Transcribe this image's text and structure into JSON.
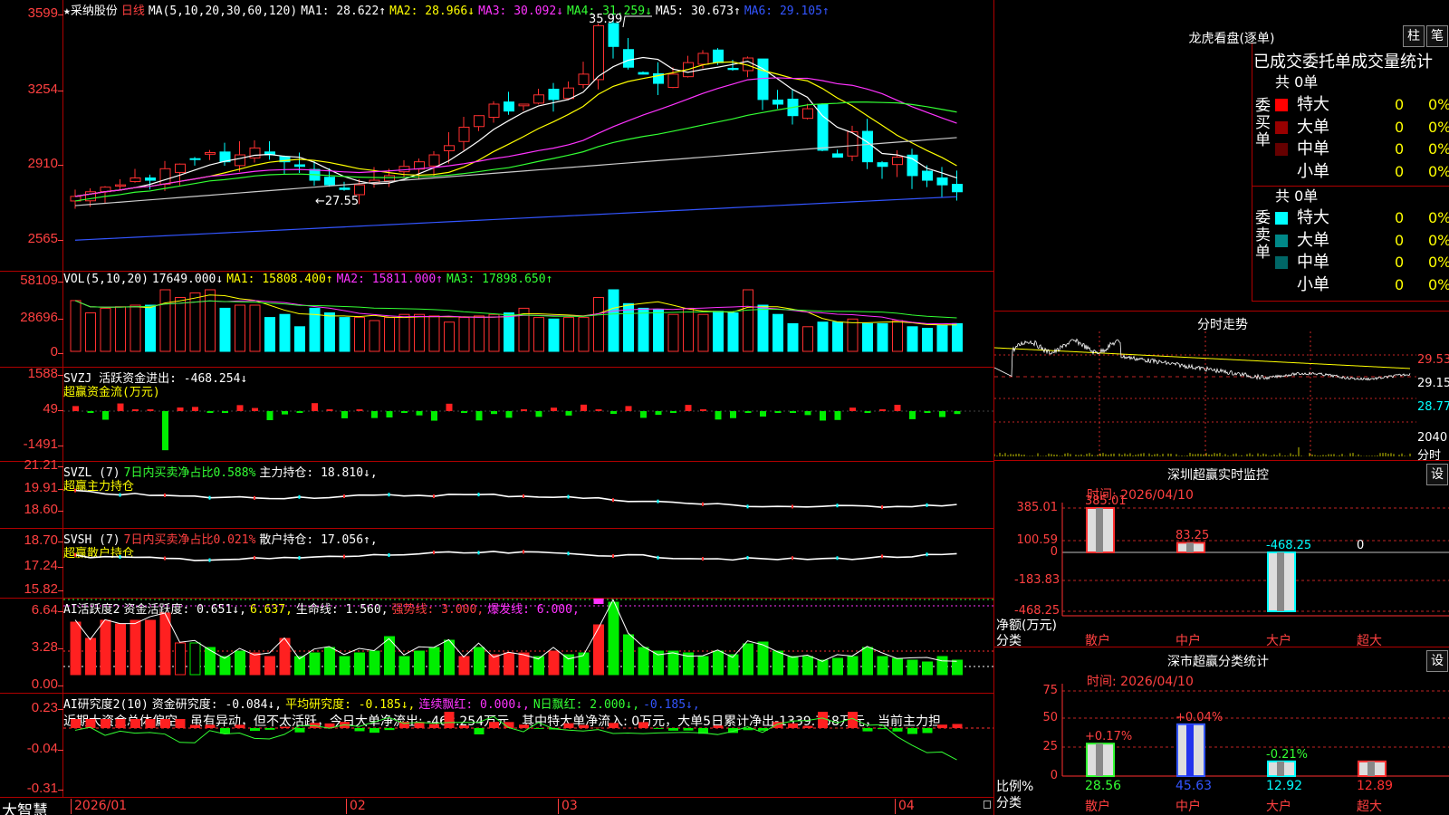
{
  "footer": {
    "app_name": "大智慧",
    "dates": [
      "2026/01",
      "02",
      "03",
      "04"
    ]
  },
  "main": {
    "stock_name": "★采纳股份",
    "period": "日线",
    "ma_header": "MA(5,10,20,30,60,120)",
    "ma": [
      {
        "label": "MA1: 28.622↑",
        "color": "#ffffff"
      },
      {
        "label": "MA2: 28.966↓",
        "color": "#ffff00"
      },
      {
        "label": "MA3: 30.092↓",
        "color": "#ff33ff"
      },
      {
        "label": "MA4: 31.259↓",
        "color": "#33ff33"
      },
      {
        "label": "MA5: 30.673↑",
        "color": "#ffffff"
      },
      {
        "label": "MA6: 29.105↑",
        "color": "#3355ff"
      }
    ],
    "y_labels": [
      "3599",
      "3254",
      "2910",
      "2565"
    ],
    "high_label": "35.99",
    "low_label": "←27.55"
  },
  "vol": {
    "header": "VOL(5,10,20)",
    "value": "17649.000↓",
    "ma1": "MA1: 15808.400↑",
    "ma2": "MA2: 15811.000↑",
    "ma3": "MA3: 17898.650↑",
    "y_labels": [
      "58109",
      "28696",
      "0"
    ]
  },
  "svzj": {
    "header": "SVZJ  活跃资金进出: -468.254↓",
    "subtitle": "超赢资金流(万元)",
    "y_labels": [
      "1588",
      "49",
      "-1491"
    ]
  },
  "svzl": {
    "header": "SVZL (7)",
    "pct": "7日内买卖净占比0.588%",
    "hold": "主力持仓: 18.810↓,",
    "subtitle": "超赢主力持仓",
    "y_labels": [
      "21.21",
      "19.91",
      "18.60"
    ]
  },
  "svsh": {
    "header": "SVSH (7)",
    "pct": "7日内买卖净占比0.021%",
    "hold": "散户持仓: 17.056↑,",
    "subtitle": "超赢散户持仓",
    "y_labels": [
      "18.70",
      "17.24",
      "15.82"
    ]
  },
  "ai1": {
    "header": "AI活跃度2",
    "a": "资金活跃度: 0.651↓,",
    "b": "6.637,",
    "c": "生命线: 1.560,",
    "d": "强势线: 3.000,",
    "e": "爆发线: 6.000,",
    "y_labels": [
      "6.64",
      "3.28",
      "0.00"
    ]
  },
  "ai2": {
    "header": "AI研究度2(10)",
    "a": "资金研究度: -0.084↓,",
    "b": "平均研究度: -0.185↓,",
    "c": "连续飘红: 0.000↓,",
    "d": "N日飘红: 2.000↓,",
    "e": "-0.185↓,",
    "comment": "近期大资金总体偏空，虽有异动，但不太活跃，今日大单净流出: -468.254万元，其中特大单净流入: 0万元，大单5日累计净出-1339.758万元，当前主力担",
    "y_labels": [
      "0.23",
      "-0.04",
      "-0.31"
    ]
  },
  "right": {
    "lhb_title": "龙虎看盘(逐单)",
    "btn1": "柱",
    "btn2": "笔",
    "tabs": "已成交委托单成交量统计",
    "buy": {
      "side": "委买单",
      "total": "共 0单",
      "rows": [
        {
          "label": "特大",
          "v": "0",
          "p": "0%",
          "color": "#ff0000"
        },
        {
          "label": "大单",
          "v": "0",
          "p": "0%",
          "color": "#990000"
        },
        {
          "label": "中单",
          "v": "0",
          "p": "0%",
          "color": "#660000"
        },
        {
          "label": "小单",
          "v": "0",
          "p": "0%",
          "color": "#000000"
        }
      ]
    },
    "sell": {
      "side": "委卖单",
      "total": "共 0单",
      "rows": [
        {
          "label": "特大",
          "v": "0",
          "p": "0%",
          "color": "#00ffff"
        },
        {
          "label": "大单",
          "v": "0",
          "p": "0%",
          "color": "#008888"
        },
        {
          "label": "中单",
          "v": "0",
          "p": "0%",
          "color": "#006666"
        },
        {
          "label": "小单",
          "v": "0",
          "p": "0%",
          "color": "#000000"
        }
      ]
    },
    "fs_title": "分时走势",
    "fs_prices": [
      "29.53",
      "29.15",
      "28.77"
    ],
    "fs_vol": "2040",
    "fs_unit": "分时",
    "sz_title": "深圳超赢实时监控",
    "btn_set": "设",
    "time1": "时间: 2026/04/10",
    "sz_y": [
      "385.01",
      "100.59",
      "0",
      "-183.83",
      "-468.25"
    ],
    "sz_vals": [
      "385.01",
      "83.25",
      "-468.25",
      "0"
    ],
    "net_label": "净额(万元)",
    "cat_label": "分类",
    "cats": [
      "散户",
      "中户",
      "大户",
      "超大"
    ],
    "cls_title": "深市超赢分类统计",
    "time2": "时间: 2026/04/10",
    "cls_y": [
      "75",
      "50",
      "25",
      "0"
    ],
    "cls_pct": [
      "+0.17%",
      "+0.04%",
      "-0.21%",
      ""
    ],
    "cls_vals": [
      "28.56",
      "45.63",
      "12.92",
      "12.89"
    ],
    "ratio_label": "比例%"
  }
}
